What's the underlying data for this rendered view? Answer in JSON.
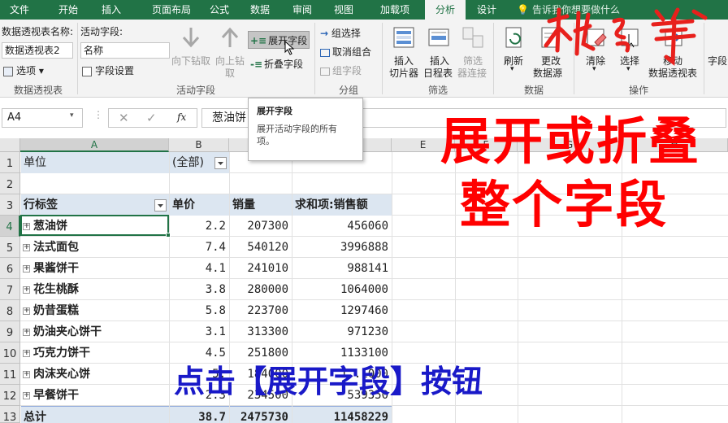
{
  "tabs": [
    {
      "label": "文件"
    },
    {
      "label": "开始"
    },
    {
      "label": "插入"
    },
    {
      "label": "页面布局"
    },
    {
      "label": "公式"
    },
    {
      "label": "数据"
    },
    {
      "label": "审阅"
    },
    {
      "label": "视图"
    },
    {
      "label": "加载项"
    },
    {
      "label": "分析"
    },
    {
      "label": "设计"
    }
  ],
  "tell_me": "告诉我你想要做什么",
  "ribbon": {
    "pivot_name_label": "数据透视表名称:",
    "pivot_name_value": "数据透视表2",
    "options_label": "选项",
    "group_pivot": "数据透视表",
    "active_field_label": "活动字段:",
    "active_field_value": "名称",
    "field_settings": "字段设置",
    "drill_down": "向下钻取",
    "drill_up": "向上钻",
    "drill_up_2": "取",
    "expand_field": "展开字段",
    "collapse_field": "折叠字段",
    "group_active_field": "活动字段",
    "group_selection": "组选择",
    "ungroup": "取消组合",
    "group_field": "组字段",
    "group_group": "分组",
    "insert_slicer_1": "插入",
    "insert_slicer_2": "切片器",
    "insert_timeline_1": "插入",
    "insert_timeline_2": "日程表",
    "filter_conn_1": "筛选",
    "filter_conn_2": "器连接",
    "group_filter": "筛选",
    "refresh": "刷新",
    "change_source_1": "更改",
    "change_source_2": "数据源",
    "group_data": "数据",
    "clear": "清除",
    "select": "选择",
    "move_pivot_1": "移动",
    "move_pivot_2": "数据透视表",
    "group_actions": "操作",
    "fields_partial": "字段"
  },
  "tooltip": {
    "title": "展开字段",
    "body": "展开活动字段的所有项。"
  },
  "formula_bar": {
    "name_box": "A4",
    "content": "葱油饼"
  },
  "columns": [
    "A",
    "B",
    "C",
    "D",
    "E",
    "F",
    "G",
    "H"
  ],
  "rows": [
    "1",
    "2",
    "3",
    "4",
    "5",
    "6",
    "7",
    "8",
    "9",
    "10",
    "11",
    "12",
    "13"
  ],
  "pivot": {
    "filter_label": "单位",
    "filter_value": "(全部)",
    "headers": [
      "行标签",
      "单价",
      "销量",
      "求和项:销售额"
    ],
    "items": [
      {
        "name": "葱油饼",
        "price": "2.2",
        "qty": "207300",
        "sales": "456060"
      },
      {
        "name": "法式面包",
        "price": "7.4",
        "qty": "540120",
        "sales": "3996888"
      },
      {
        "name": "果酱饼干",
        "price": "4.1",
        "qty": "241010",
        "sales": "988141"
      },
      {
        "name": "花生桃酥",
        "price": "3.8",
        "qty": "280000",
        "sales": "1064000"
      },
      {
        "name": "奶昔蛋糕",
        "price": "5.8",
        "qty": "223700",
        "sales": "1297460"
      },
      {
        "name": "奶油夹心饼干",
        "price": "3.1",
        "qty": "313300",
        "sales": "971230"
      },
      {
        "name": "巧克力饼干",
        "price": "4.5",
        "qty": "251800",
        "sales": "1133100"
      },
      {
        "name": "肉沫夹心饼",
        "price": "5.",
        "qty": "184000",
        "sales": "1..1000"
      },
      {
        "name": "早餐饼干",
        "price": "2.3",
        "qty": "234500",
        "sales": "539350"
      }
    ],
    "total_label": "总计",
    "total_price": "38.7",
    "total_qty": "2475730",
    "total_sales": "11458229"
  },
  "overlay": {
    "title_line1": "展开或折叠",
    "title_line2": "整个字段",
    "caption": "点击【展开字段】按钮"
  },
  "colors": {
    "excel_green": "#217346",
    "overlay_red": "#ff0000",
    "overlay_blue": "#1919c8",
    "pivot_header_bg": "#dce6f1"
  }
}
